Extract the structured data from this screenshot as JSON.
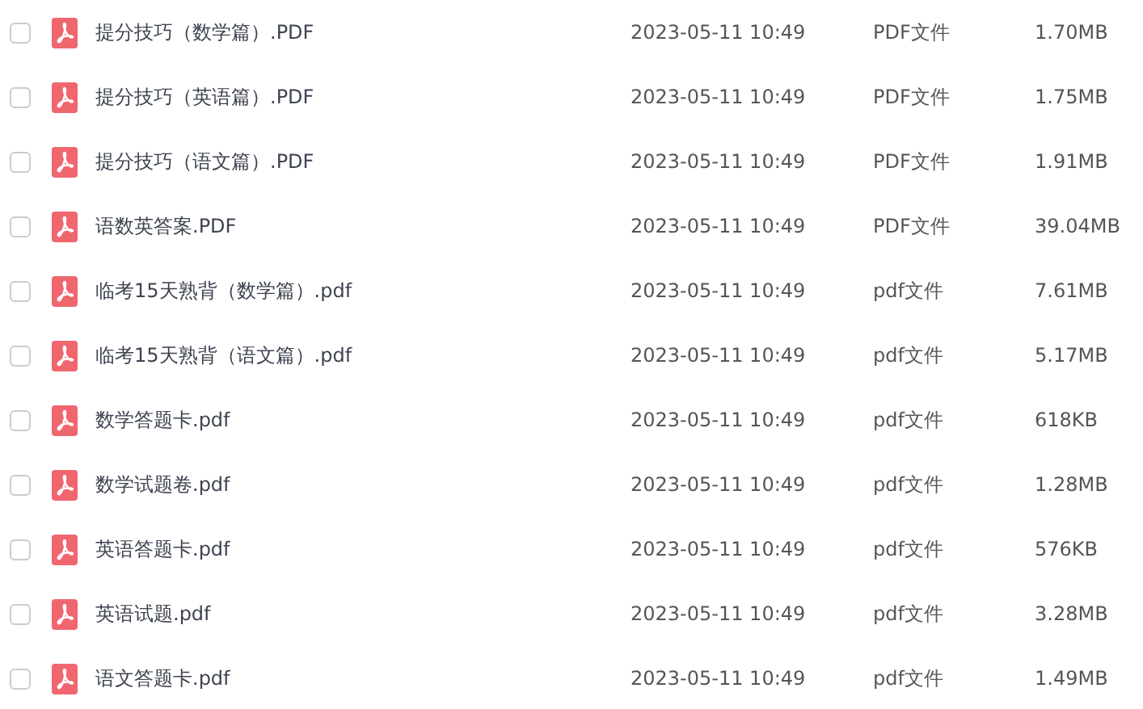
{
  "files": [
    {
      "checked": false,
      "name": "提分技巧（数学篇）.PDF",
      "modified": "2023-05-11 10:49",
      "type": "PDF文件",
      "size": "1.70MB"
    },
    {
      "checked": false,
      "name": "提分技巧（英语篇）.PDF",
      "modified": "2023-05-11 10:49",
      "type": "PDF文件",
      "size": "1.75MB"
    },
    {
      "checked": false,
      "name": "提分技巧（语文篇）.PDF",
      "modified": "2023-05-11 10:49",
      "type": "PDF文件",
      "size": "1.91MB"
    },
    {
      "checked": false,
      "name": "语数英答案.PDF",
      "modified": "2023-05-11 10:49",
      "type": "PDF文件",
      "size": "39.04MB"
    },
    {
      "checked": false,
      "name": "临考15天熟背（数学篇）.pdf",
      "modified": "2023-05-11 10:49",
      "type": "pdf文件",
      "size": "7.61MB"
    },
    {
      "checked": false,
      "name": "临考15天熟背（语文篇）.pdf",
      "modified": "2023-05-11 10:49",
      "type": "pdf文件",
      "size": "5.17MB"
    },
    {
      "checked": false,
      "name": "数学答题卡.pdf",
      "modified": "2023-05-11 10:49",
      "type": "pdf文件",
      "size": "618KB"
    },
    {
      "checked": false,
      "name": "数学试题卷.pdf",
      "modified": "2023-05-11 10:49",
      "type": "pdf文件",
      "size": "1.28MB"
    },
    {
      "checked": false,
      "name": "英语答题卡.pdf",
      "modified": "2023-05-11 10:49",
      "type": "pdf文件",
      "size": "576KB"
    },
    {
      "checked": false,
      "name": "英语试题.pdf",
      "modified": "2023-05-11 10:49",
      "type": "pdf文件",
      "size": "3.28MB"
    },
    {
      "checked": false,
      "name": "语文答题卡.pdf",
      "modified": "2023-05-11 10:49",
      "type": "pdf文件",
      "size": "1.49MB"
    }
  ]
}
